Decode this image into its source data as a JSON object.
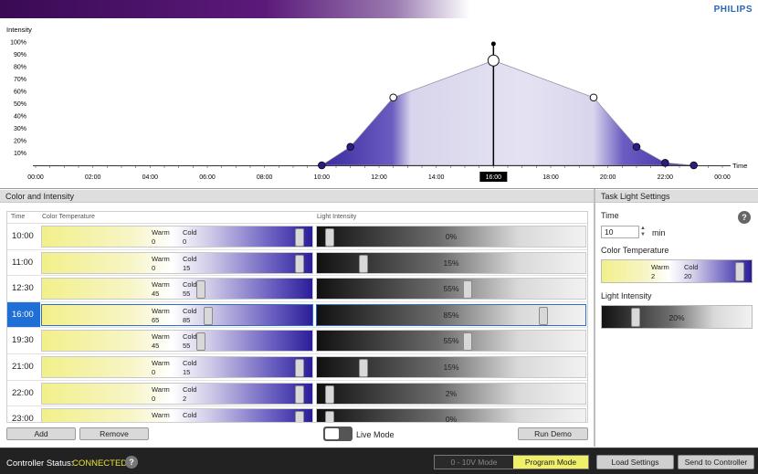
{
  "brand": "PHILIPS",
  "chart_data": {
    "type": "area",
    "ylabel": "Intensity",
    "xlabel": "Time",
    "y_ticks": [
      "10%",
      "20%",
      "30%",
      "40%",
      "50%",
      "60%",
      "70%",
      "80%",
      "90%",
      "100%"
    ],
    "x_ticks": [
      "00:00",
      "02:00",
      "04:00",
      "06:00",
      "08:00",
      "10:00",
      "12:00",
      "14:00",
      "16:00",
      "18:00",
      "20:00",
      "22:00",
      "00:00"
    ],
    "ylim": [
      0,
      100
    ],
    "xlim": [
      0,
      24
    ],
    "selected_time": "16:00",
    "x": [
      10,
      11,
      12.5,
      16,
      19.5,
      21,
      22,
      23
    ],
    "y": [
      0,
      15,
      55,
      85,
      55,
      15,
      2,
      0
    ],
    "color_temp_cold": [
      0,
      15,
      55,
      85,
      55,
      15,
      2,
      0
    ]
  },
  "left_panel": {
    "title": "Color and Intensity"
  },
  "right_panel": {
    "title": "Task Light Settings"
  },
  "table": {
    "headers": {
      "time": "Time",
      "color": "Color Temperature",
      "light": "Light Intensity"
    },
    "warm_label": "Warm",
    "cold_label": "Cold",
    "rows": [
      {
        "time": "10:00",
        "warm": "0",
        "cold": "0",
        "intensity": "0%",
        "ct_pos": 0.97,
        "li_pos": 0.03
      },
      {
        "time": "11:00",
        "warm": "0",
        "cold": "15",
        "intensity": "15%",
        "ct_pos": 0.97,
        "li_pos": 0.16
      },
      {
        "time": "12:30",
        "warm": "45",
        "cold": "55",
        "intensity": "55%",
        "ct_pos": 0.59,
        "li_pos": 0.56
      },
      {
        "time": "16:00",
        "warm": "65",
        "cold": "85",
        "intensity": "85%",
        "ct_pos": 0.62,
        "li_pos": 0.85,
        "selected": true
      },
      {
        "time": "19:30",
        "warm": "45",
        "cold": "55",
        "intensity": "55%",
        "ct_pos": 0.59,
        "li_pos": 0.56
      },
      {
        "time": "21:00",
        "warm": "0",
        "cold": "15",
        "intensity": "15%",
        "ct_pos": 0.97,
        "li_pos": 0.16
      },
      {
        "time": "22:00",
        "warm": "0",
        "cold": "2",
        "intensity": "2%",
        "ct_pos": 0.97,
        "li_pos": 0.03
      },
      {
        "time": "23:00",
        "warm": "",
        "cold": "",
        "intensity": "0%",
        "ct_pos": 0.97,
        "li_pos": 0.03
      }
    ]
  },
  "buttons": {
    "add": "Add",
    "remove": "Remove",
    "run_demo": "Run Demo",
    "live_mode": "Live Mode"
  },
  "task": {
    "time_label": "Time",
    "time_value": "10",
    "time_unit": "min",
    "ct_label": "Color Temperature",
    "ct_warm": "2",
    "ct_cold": "20",
    "li_label": "Light Intensity",
    "li_value": "20%",
    "help": "?"
  },
  "footer": {
    "status_label": "Controller Status:",
    "status_value": "CONNECTED",
    "help": "?",
    "mode_0": "0 - 10V Mode",
    "mode_1": "Program Mode",
    "load": "Load Settings",
    "send": "Send to Controller"
  },
  "colors": {
    "accent_yellow": "#f0ef6a",
    "selection": "#1f6fd6",
    "cold_purple": "#2a1d9a"
  }
}
